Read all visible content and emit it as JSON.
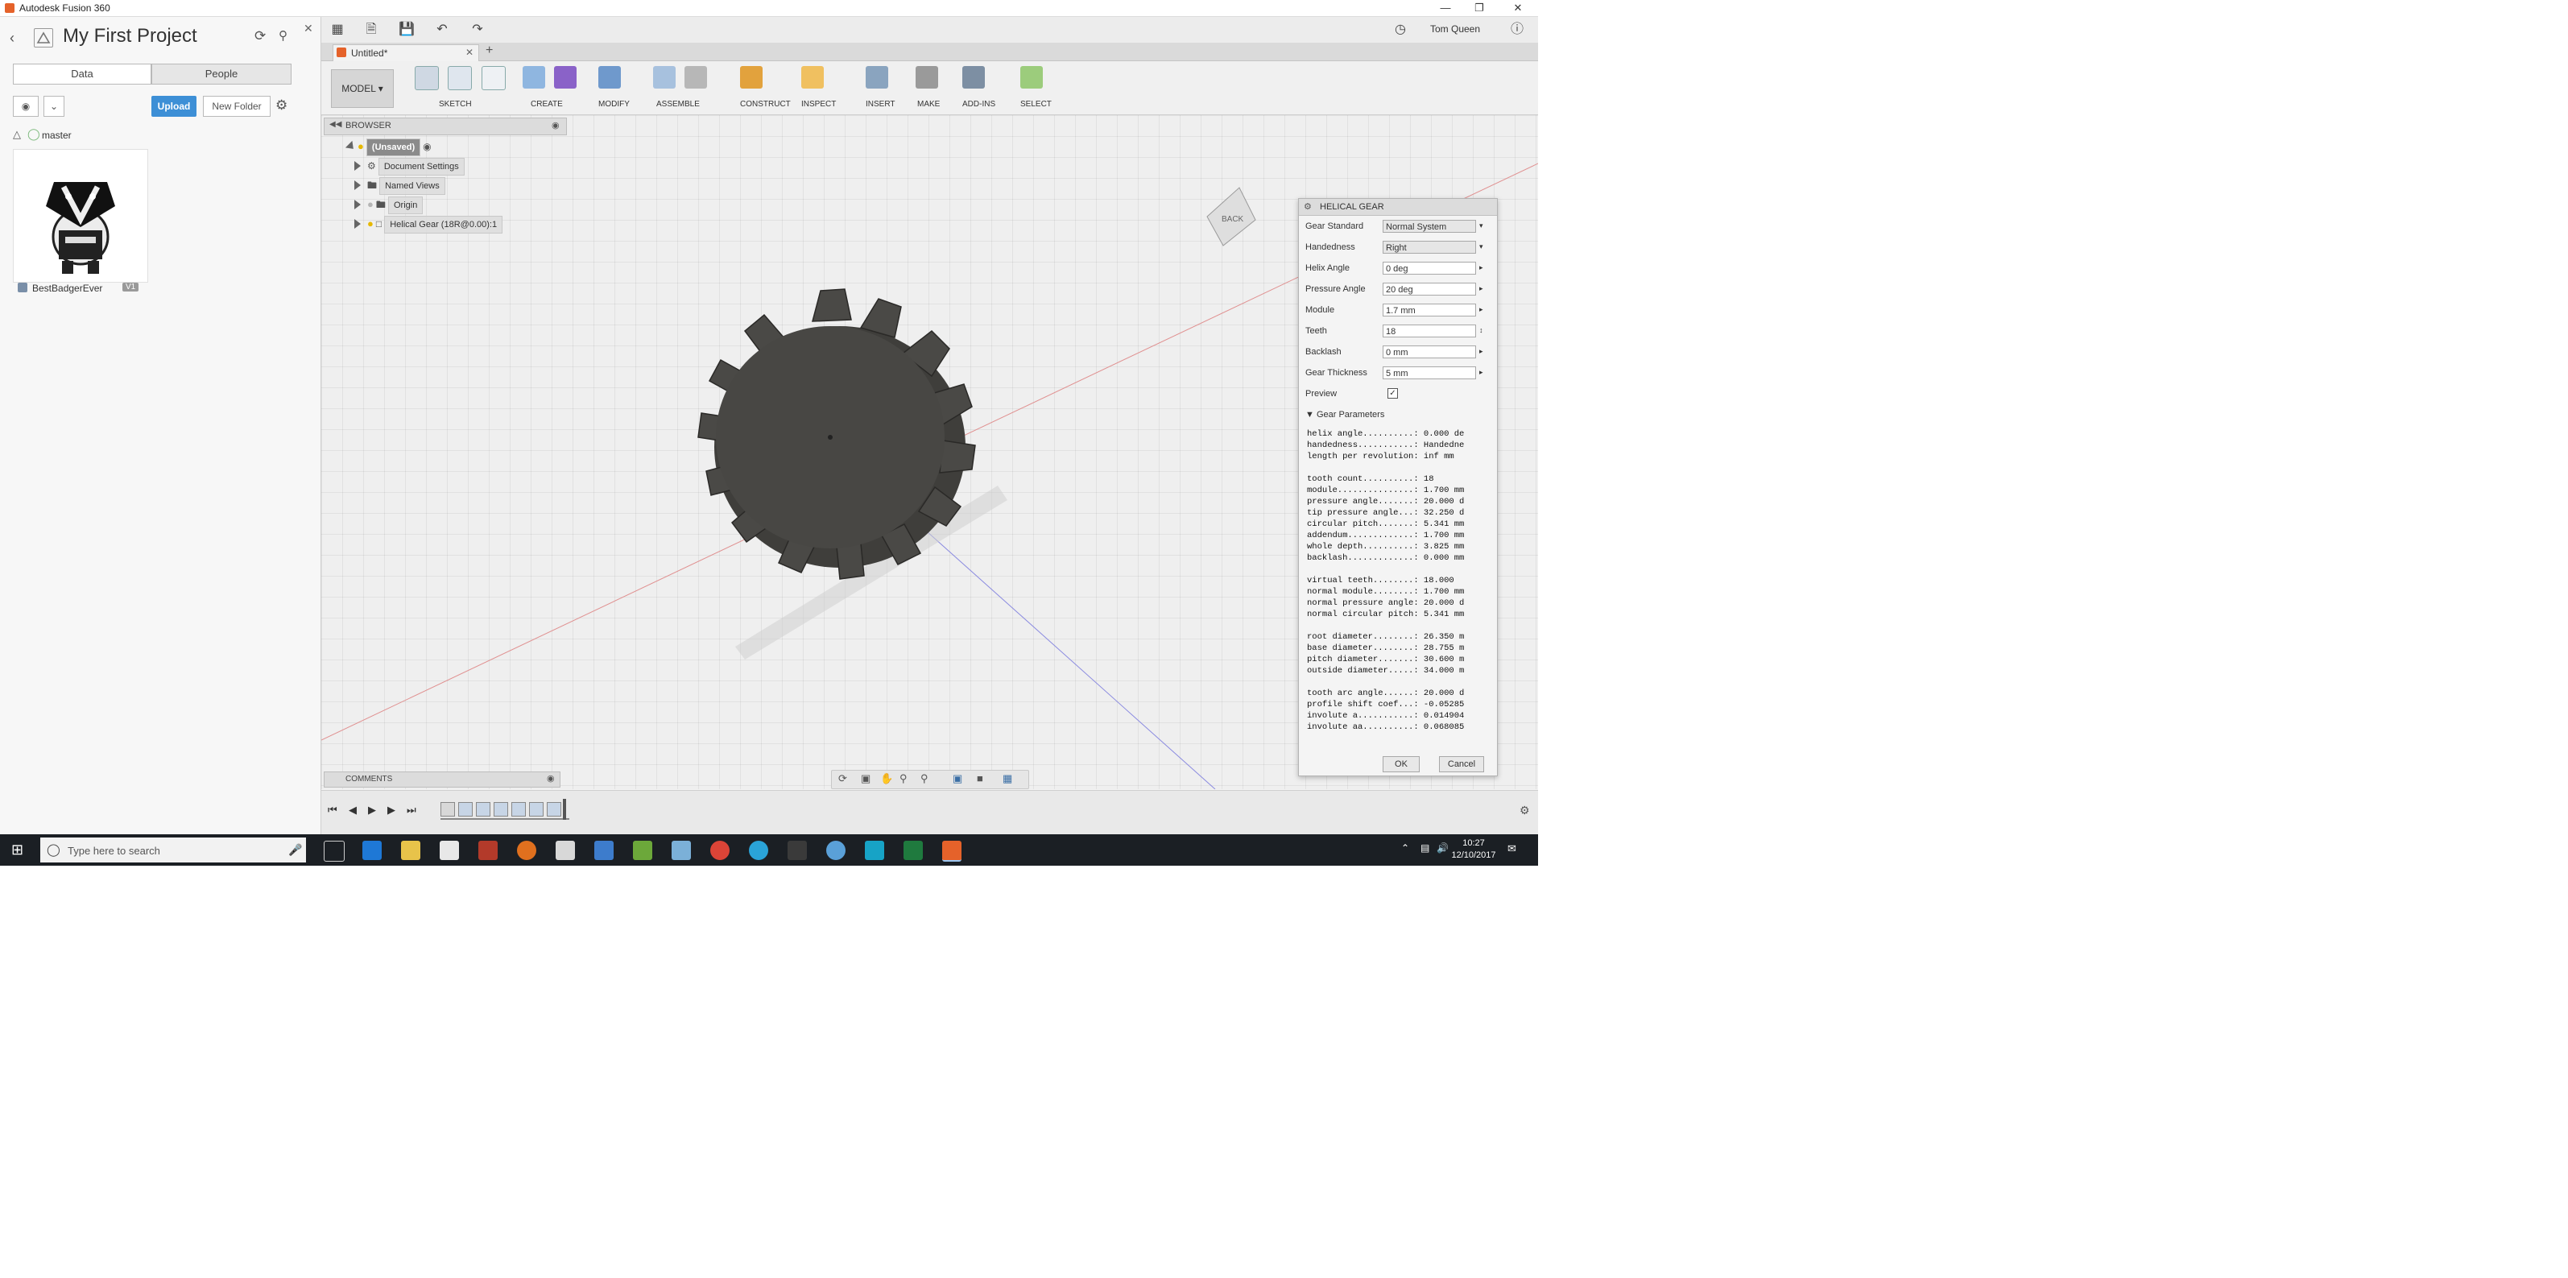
{
  "window": {
    "title": "Autodesk Fusion 360"
  },
  "data_panel": {
    "project_title": "My First Project",
    "tabs": [
      "Data",
      "People"
    ],
    "upload_label": "Upload",
    "new_folder_label": "New Folder",
    "branch": "master",
    "item_name": "BestBadgerEver",
    "item_version": "V1"
  },
  "document": {
    "tab_title": "Untitled*"
  },
  "quickbar": {
    "user_name": "Tom Queen"
  },
  "ribbon": {
    "workspace": "MODEL",
    "groups": [
      "SKETCH",
      "CREATE",
      "MODIFY",
      "ASSEMBLE",
      "CONSTRUCT",
      "INSPECT",
      "INSERT",
      "MAKE",
      "ADD-INS",
      "SELECT"
    ]
  },
  "browser": {
    "title": "BROWSER",
    "root": "(Unsaved)",
    "items": [
      "Document Settings",
      "Named Views",
      "Origin",
      "Helical Gear (18R@0.00):1"
    ]
  },
  "viewcube": {
    "face": "BACK"
  },
  "dialog": {
    "title": "HELICAL GEAR",
    "fields": [
      {
        "label": "Gear Standard",
        "value": "Normal System"
      },
      {
        "label": "Handedness",
        "value": "Right"
      },
      {
        "label": "Helix Angle",
        "value": "0 deg"
      },
      {
        "label": "Pressure Angle",
        "value": "20 deg"
      },
      {
        "label": "Module",
        "value": "1.7 mm"
      },
      {
        "label": "Teeth",
        "value": "18"
      },
      {
        "label": "Backlash",
        "value": "0 mm"
      },
      {
        "label": "Gear Thickness",
        "value": "5 mm"
      }
    ],
    "preview_label": "Preview",
    "section_title": "Gear Parameters",
    "parameters": [
      "helix angle..........: 0.000 de",
      "handedness...........: Handedne",
      "length per revolution: inf mm",
      "",
      "tooth count..........: 18",
      "module...............: 1.700 mm",
      "pressure angle.......: 20.000 d",
      "tip pressure angle...: 32.250 d",
      "circular pitch.......: 5.341 mm",
      "addendum.............: 1.700 mm",
      "whole depth..........: 3.825 mm",
      "backlash.............: 0.000 mm",
      "",
      "virtual teeth........: 18.000",
      "normal module........: 1.700 mm",
      "normal pressure angle: 20.000 d",
      "normal circular pitch: 5.341 mm",
      "",
      "root diameter........: 26.350 m",
      "base diameter........: 28.755 m",
      "pitch diameter.......: 30.600 m",
      "outside diameter.....: 34.000 m",
      "",
      "tooth arc angle......: 20.000 d",
      "profile shift coef...: -0.05285",
      "involute a...........: 0.014904",
      "involute aa..........: 0.068085"
    ],
    "ok_label": "OK",
    "cancel_label": "Cancel"
  },
  "comments": {
    "title": "COMMENTS"
  },
  "taskbar": {
    "search_placeholder": "Type here to search",
    "time": "10:27",
    "date": "12/10/2017"
  }
}
